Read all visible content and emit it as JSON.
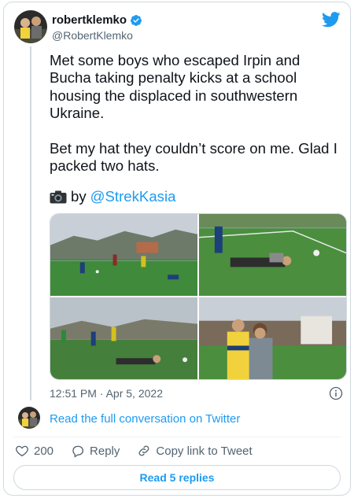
{
  "author": {
    "name": "robertklemko",
    "handle": "@RobertKlemko",
    "verified": true
  },
  "tweet": {
    "text": "Met some boys who escaped Irpin and Bucha taking penalty kicks at a school housing the displaced in southwestern Ukraine.\n\nBet my hat they couldn’t score on me. Glad I packed two hats.",
    "credit_prefix": "by",
    "credit_link": "@StrekKasia",
    "timestamp": "12:51 PM · Apr 5, 2022"
  },
  "conversation": {
    "label": "Read the full conversation on Twitter"
  },
  "actions": {
    "like_count": "200",
    "reply_label": "Reply",
    "copy_label": "Copy link to Tweet"
  },
  "footer": {
    "read_replies": "Read 5 replies"
  },
  "colors": {
    "accent": "#1d9bf0",
    "secondary_text": "#536471",
    "border": "#cfd9de"
  },
  "icons": [
    "verified-badge-icon",
    "twitter-bird-icon",
    "camera-icon",
    "info-icon",
    "heart-icon",
    "reply-icon",
    "link-icon"
  ]
}
